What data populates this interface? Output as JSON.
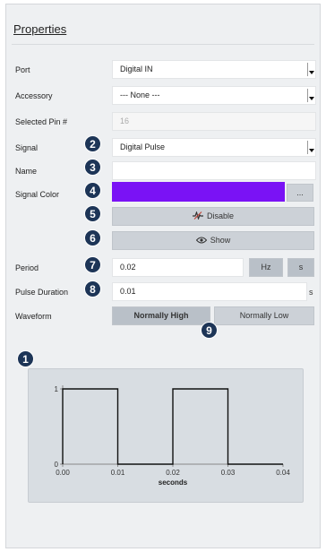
{
  "panel": {
    "title": "Properties",
    "rows": {
      "port": {
        "label": "Port",
        "value": "Digital IN"
      },
      "accessory": {
        "label": "Accessory",
        "value": "--- None ---"
      },
      "selected_pin": {
        "label": "Selected Pin #",
        "value": "16"
      },
      "signal": {
        "label": "Signal",
        "value": "Digital Pulse",
        "badge": "2"
      },
      "name": {
        "label": "Name",
        "value": "",
        "badge": "3"
      },
      "signal_color": {
        "label": "Signal Color",
        "color": "#7a12f5",
        "more": "...",
        "badge": "4"
      },
      "disable": {
        "label": "Disable",
        "icon": "signal-wave-icon",
        "badge": "5"
      },
      "show": {
        "label": "Show",
        "icon": "eye-icon",
        "badge": "6"
      },
      "period": {
        "label": "Period",
        "value": "0.02",
        "unit_hz": "Hz",
        "unit_s": "s",
        "badge": "7"
      },
      "pulse_duration": {
        "label": "Pulse Duration",
        "value": "0.01",
        "unit": "s",
        "badge": "8"
      },
      "waveform": {
        "label": "Waveform",
        "option_high": "Normally High",
        "option_low": "Normally Low",
        "selected": "Normally High",
        "badge": "9"
      }
    },
    "chart_badge": "1"
  },
  "chart_data": {
    "type": "line",
    "xlabel": "seconds",
    "ylabel": "",
    "xlim": [
      0.0,
      0.04
    ],
    "ylim": [
      0,
      1
    ],
    "x_ticks": [
      "0.00",
      "0.01",
      "0.02",
      "0.03",
      "0.04"
    ],
    "y_ticks": [
      "0",
      "1"
    ],
    "series": [
      {
        "x": [
          0.0,
          0.0,
          0.01,
          0.01,
          0.02,
          0.02,
          0.03,
          0.03,
          0.04
        ],
        "y": [
          0,
          1,
          1,
          0,
          0,
          1,
          1,
          0,
          0
        ]
      }
    ]
  }
}
